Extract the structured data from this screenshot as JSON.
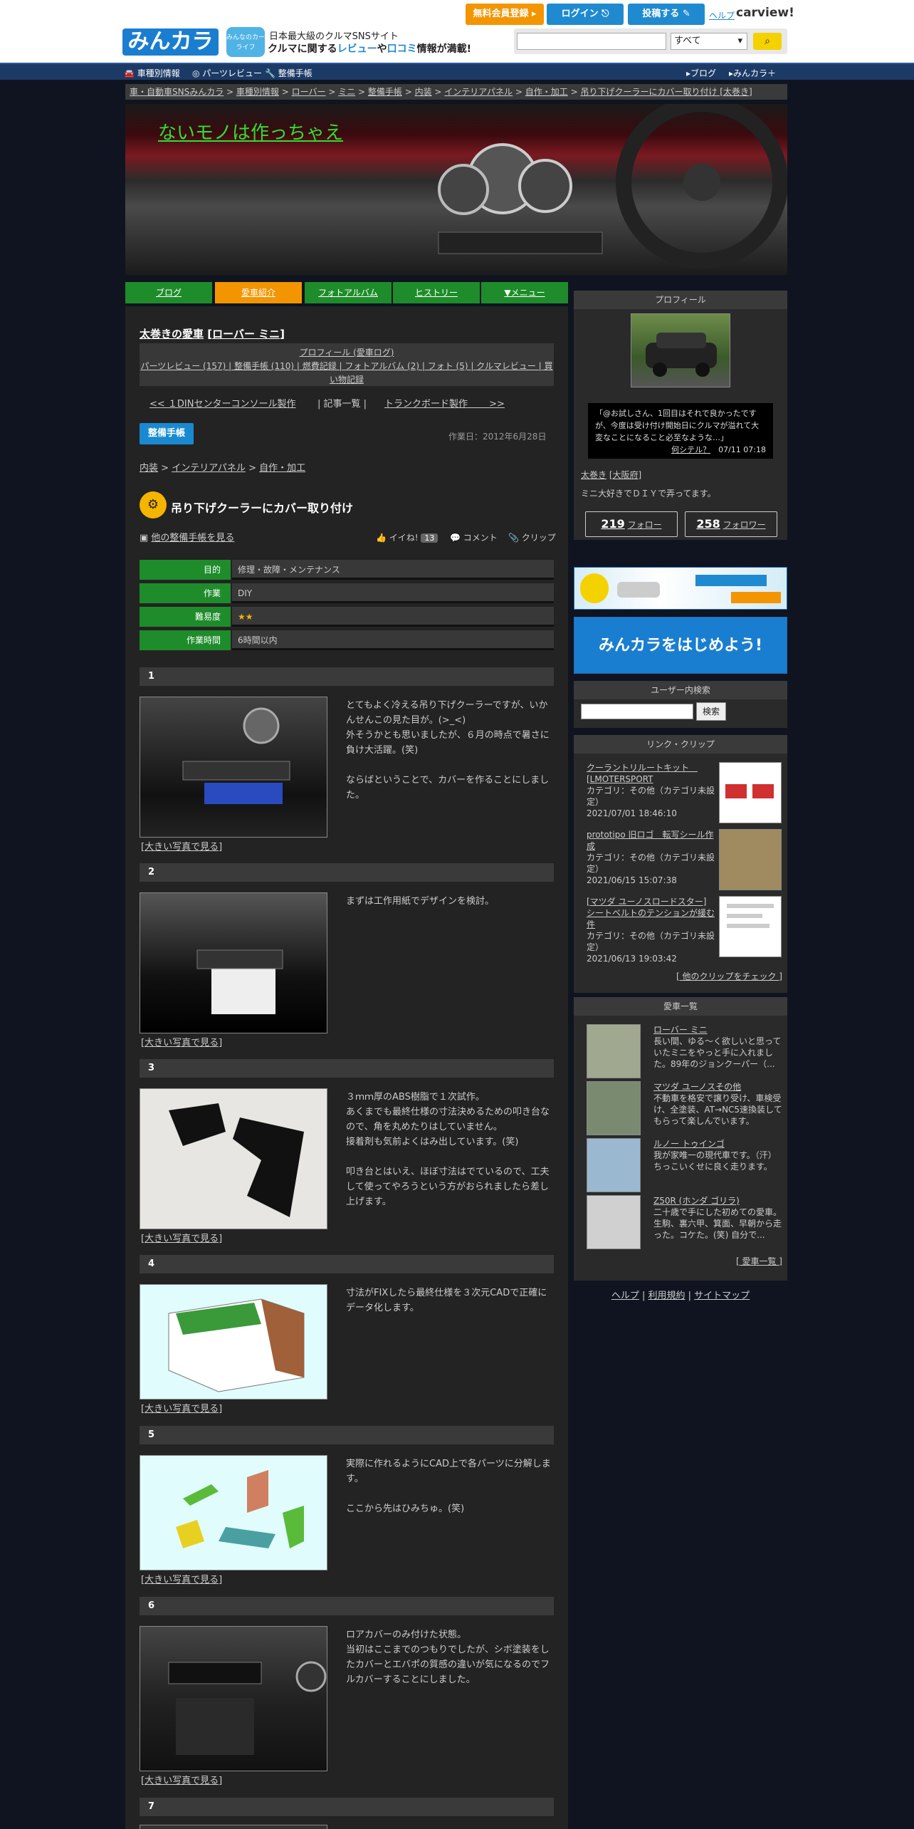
{
  "header": {
    "logo": "みんカラ",
    "mascot": "みんなのカーライフ",
    "tagline1": "日本最大級のクルマSNSサイト",
    "tagline2_a": "クルマに関する",
    "tagline2_b": "レビュー",
    "tagline2_c": "や",
    "tagline2_d": "口コミ",
    "tagline2_e": "情報が満載!",
    "btn_register": "無料会員登録",
    "btn_login": "ログイン",
    "btn_post": "投稿する",
    "help": "ヘルプ",
    "carview": "carview!",
    "search_select": "すべて"
  },
  "nav": {
    "items": [
      "車種別情報",
      "パーツレビュー",
      "整備手帳"
    ],
    "right": [
      "ブログ",
      "みんカラ＋"
    ]
  },
  "breadcrumb": [
    "車・自動車SNSみんカラ",
    "車種別情報",
    "ローバー",
    "ミニ",
    "整備手帳",
    "内装",
    "インテリアパネル",
    "自作・加工",
    "吊り下げクーラーにカバー取り付け [太巻き]"
  ],
  "blog_title": "ないモノは作っちゃえ",
  "tabs": [
    "ブログ",
    "愛車紹介",
    "フォトアルバム",
    "ヒストリー",
    "▼メニュー"
  ],
  "profile_head": {
    "owner": "太巻きの愛車",
    "car": "ローバー ミニ",
    "links": "プロフィール (愛車ログ)",
    "links2": "パーツレビュー (157) | 整備手帳 (110) | 燃費記録 | フォトアルバム (2) | フォト (5) | クルマレビュー | 買い物記録"
  },
  "prevnext": {
    "prev": "<< １DINセンターコンソール製作",
    "list": "| 記事一覧 |",
    "next": "トランクボード製作　　 >>"
  },
  "badge": "整備手帳",
  "work_date": "作業日：2012年6月28日",
  "cats": [
    "内装",
    "インテリアパネル",
    "自作・加工"
  ],
  "post_title": "吊り下げクーラーにカバー取り付け",
  "other_link": "他の整備手帳を見る",
  "actions": {
    "like": "イイね!",
    "like_count": "13",
    "comment": "コメント",
    "clip": "クリップ"
  },
  "info": [
    {
      "k": "目的",
      "v": "修理・故障・メンテナンス"
    },
    {
      "k": "作業",
      "v": "DIY"
    },
    {
      "k": "難易度",
      "v": "★★"
    },
    {
      "k": "作業時間",
      "v": "6時間以内"
    }
  ],
  "steps": [
    {
      "n": "1",
      "text": "とてもよく冷える吊り下げクーラーですが、いかんせんこの見た目が。(>_<)\n外そうかとも思いましたが、６月の時点で暑さに負け大活躍。(笑)\n\nならばということで、カバーを作ることにしました。"
    },
    {
      "n": "2",
      "text": "まずは工作用紙でデザインを検討。"
    },
    {
      "n": "3",
      "text": "３ｍｍ厚のABS樹脂で１次試作。\nあくまでも最終仕様の寸法決めるための叩き台なので、角を丸めたりはしていません。\n接着剤も気前よくはみ出しています。(笑)\n\n叩き台とはいえ、ほぼ寸法はでているので、工夫して使ってやろうという方がおられましたら差し上げます。"
    },
    {
      "n": "4",
      "text": "寸法がFIXしたら最終仕様を３次元CADで正確にデータ化します。"
    },
    {
      "n": "5",
      "text": "実際に作れるようにCAD上で各パーツに分解します。\n\nここから先はひみちゅ。(笑)"
    },
    {
      "n": "6",
      "text": "ロアカバーのみ付けた状態。\n当初はここまでのつもりでしたが、シボ塗装をしたカバーとエバポの質感の違いが気になるのでフルカバーすることにしました。"
    },
    {
      "n": "7",
      "text": ""
    }
  ],
  "more_photo": "[大きい写真で見る]",
  "sidebar": {
    "profile_title": "プロフィール",
    "speech": "「@お試しさん、1回目はそれで良かったですが、今度は受け付け開始日にクルマが溢れて大変なことになること必至なような…」",
    "speech_link": "何シテル？",
    "speech_time": "07/11 07:18",
    "owner_name": "太巻き",
    "owner_area": "大阪府",
    "intro": "ミニ大好きでＤＩＹで弄ってます。",
    "follow": "219",
    "follow_label": "フォロー",
    "follower": "258",
    "follower_label": "フォロワー",
    "ad2": "みんカラをはじめよう!",
    "user_search_title": "ユーザー内検索",
    "user_search_btn": "検索",
    "clip_title": "リンク・クリップ",
    "clips": [
      {
        "t": "クーラントリルートキット　[LMOTERSPORT",
        "c": "カテゴリ：その他（カテゴリ未設定）",
        "d": "2021/07/01 18:46:10"
      },
      {
        "t": "prototipo 旧ロゴ　転写シール作成",
        "c": "カテゴリ：その他（カテゴリ未設定）",
        "d": "2021/06/15 15:07:38"
      },
      {
        "t": "[マツダ ユーノスロードスター]シートベルトのテンションが緩む件",
        "c": "カテゴリ：その他（カテゴリ未設定）",
        "d": "2021/06/13 19:03:42"
      }
    ],
    "clip_more": "[ 他のクリップをチェック ]",
    "cars_title": "愛車一覧",
    "cars": [
      {
        "t": "ローバー ミニ",
        "d": "長い間、ゆる～く欲しいと思っていたミニをやっと手に入れました。89年のジョンクーパー（..."
      },
      {
        "t": "マツダ ユーノスその他",
        "d": "不動車を格安で譲り受け、車検受け、全塗装、AT→NC5速換装してもらって楽しんでいます。"
      },
      {
        "t": "ルノー トゥインゴ",
        "d": "我が家唯一の現代車です。（汗）ちっこいくせに良く走ります。"
      },
      {
        "t": "Z50R (ホンダ ゴリラ)",
        "d": "二十歳で手にした初めての愛車。生駒、裏六甲、箕面、早朝から走った。コケた。(笑) 自分で..."
      }
    ],
    "cars_more": "[ 愛車一覧 ]"
  },
  "footer": [
    "ヘルプ",
    "利用規約",
    "サイトマップ"
  ],
  "colors": {
    "accent_green": "#1e8c2a",
    "accent_orange": "#f39500",
    "accent_blue": "#1f8ad0",
    "title_green": "#33dd33"
  }
}
